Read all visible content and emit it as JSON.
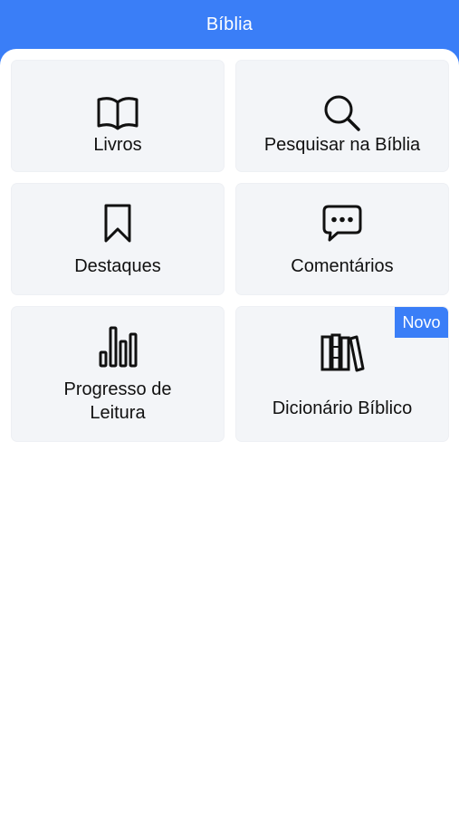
{
  "header": {
    "title": "Bíblia"
  },
  "menu": {
    "items": [
      {
        "label": "Livros",
        "icon": "open-book-icon"
      },
      {
        "label": "Pesquisar na Bíblia",
        "icon": "search-icon"
      },
      {
        "label": "Destaques",
        "icon": "bookmark-icon"
      },
      {
        "label": "Comentários",
        "icon": "comment-bubble-icon"
      },
      {
        "label_line1": "Progresso de",
        "label_line2": "Leitura",
        "icon": "bar-chart-icon"
      },
      {
        "label": "Dicionário Bíblico",
        "icon": "books-icon",
        "badge": "Novo"
      }
    ]
  },
  "colors": {
    "accent": "#3a7ef7",
    "card_background": "#f3f5f8",
    "text": "#111111"
  }
}
